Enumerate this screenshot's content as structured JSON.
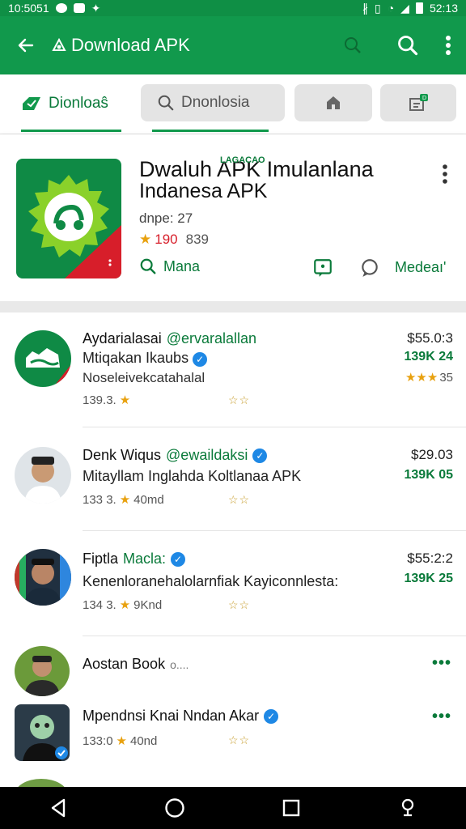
{
  "status_bar": {
    "time": "10:5051",
    "clock": "52:13"
  },
  "app_bar": {
    "title": "Download APK"
  },
  "tabs": {
    "tab1_label": "Dionloaŝ",
    "tab2_label": "Dnonlosia"
  },
  "featured": {
    "name_line1": "Dwaluh APK Imulanlana",
    "small_tag_top": "LAGACAO",
    "name_line2": "Indanesa APK",
    "meta": "dnpe: 27",
    "rating_num": "190",
    "rating_count": "839",
    "manage_label": "Mana",
    "manage_label2": "Medeaı'"
  },
  "list": [
    {
      "name": "Aydarialasai",
      "handle": "@ervaralallan",
      "line2": "Mtiqakan Ikaubs",
      "line3": "Noseleivekcatahalal",
      "meta": "139.3.",
      "price": "$55.0:3",
      "size": "139K 24",
      "rating": "35"
    },
    {
      "name": "Denk Wiqus",
      "handle": "@ewaildaksi",
      "line2": "Mitayllam Inglahda Koltlanaa APK",
      "meta": "133 3.",
      "meta2": "40md",
      "price": "$29.03",
      "size": "139K 05"
    },
    {
      "name": "Fiptla",
      "handle": "Macla:",
      "line2": "Kenenloranehalolarnfiak Kayiconnlesta:",
      "meta": "134 3.",
      "meta2": "9Knd",
      "price": "$55:2:2",
      "size": "139K 25"
    },
    {
      "name": "Aostan Book",
      "sub": "o....",
      "more": "•••"
    },
    {
      "name": "Mpendnsi Knai Nndan Akar",
      "meta": "133:0",
      "meta2": "40nd",
      "more": "•••"
    }
  ]
}
